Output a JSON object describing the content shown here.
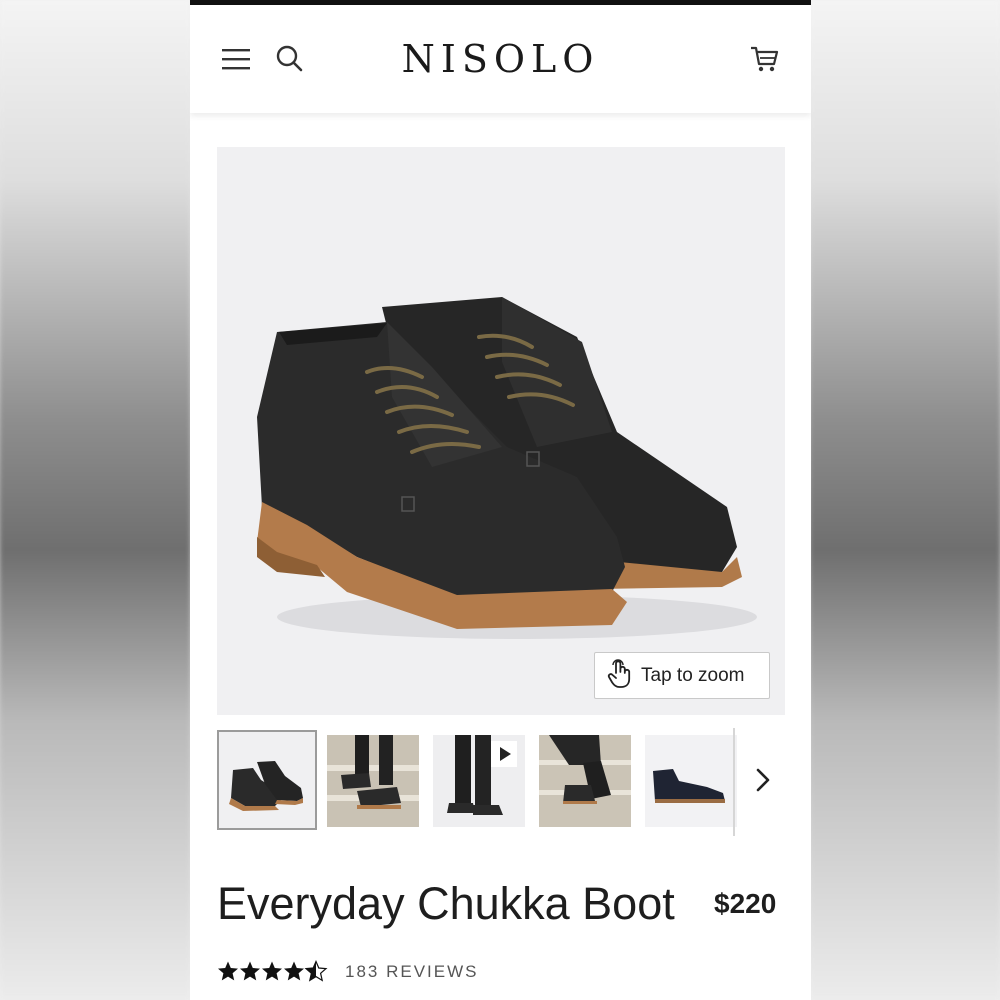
{
  "header": {
    "logo_text": "NISOLO",
    "menu_icon": "hamburger-menu-icon",
    "search_icon": "search-icon",
    "cart_icon": "shopping-cart-icon"
  },
  "gallery": {
    "main_image_subject": "pair of black leather chukka boots with brown laces and tan leather soles",
    "zoom_label": "Tap to zoom",
    "zoom_icon": "tap-hand-icon",
    "thumbnails": [
      {
        "subject": "black chukka boots pair, studio",
        "selected": true
      },
      {
        "subject": "model wearing boots on stone steps",
        "selected": false
      },
      {
        "subject": "model standing in black boots, video",
        "selected": false,
        "has_video": true
      },
      {
        "subject": "model stepping on stone stairs",
        "selected": false
      },
      {
        "subject": "single black chukka boot side view",
        "selected": false
      }
    ],
    "play_icon": "play-icon",
    "next_icon": "chevron-right-icon"
  },
  "product": {
    "title": "Everyday Chukka Boot",
    "price": "$220",
    "rating": 4.5,
    "rating_max": 5,
    "reviews_label": "183 REVIEWS"
  },
  "colors": {
    "header_rule": "#111111",
    "hero_bg": "#f0f0f2",
    "boot_leather": "#2a2a2a",
    "sole": "#b07a4a",
    "laces": "#7a6a45"
  }
}
